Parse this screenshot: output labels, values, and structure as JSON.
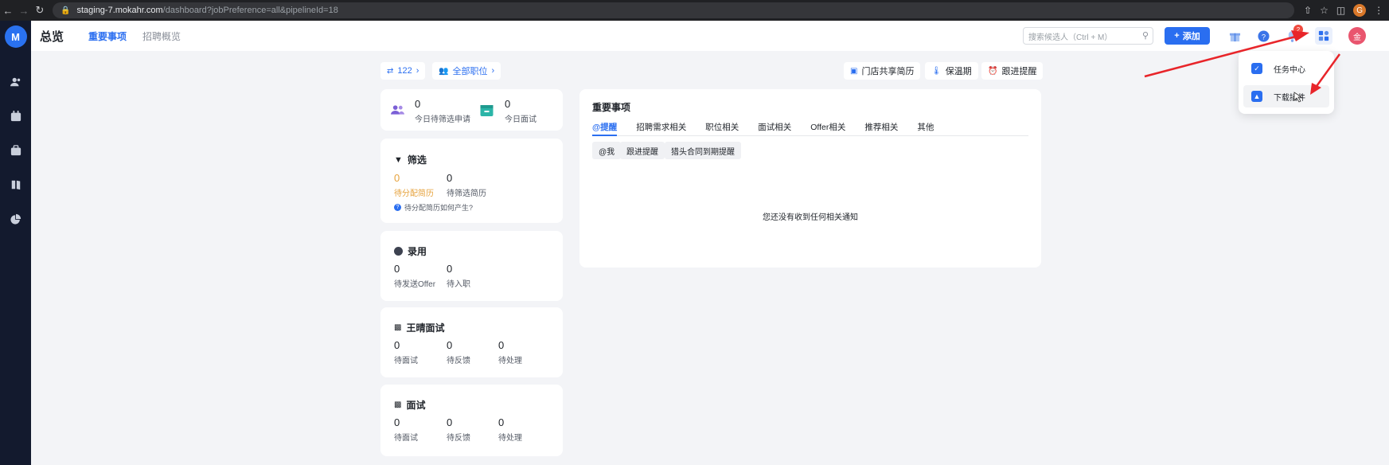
{
  "browser": {
    "url_host": "staging-7.mokahr.com",
    "url_path": "/dashboard?jobPreference=all&pipelineId=18",
    "profile_initial": "G"
  },
  "sidebar": {
    "logo_text": "M"
  },
  "header": {
    "title": "总览",
    "tabs": [
      {
        "label": "重要事项"
      },
      {
        "label": "招聘概览"
      }
    ],
    "search_placeholder": "搜索候选人（Ctrl + M）",
    "add_label": "添加",
    "notification_count": "2",
    "avatar_text": "金"
  },
  "filters": {
    "pipeline": "122",
    "jobs": "全部职位",
    "store_resume": "门店共享简历",
    "warranty": "保温期",
    "followup": "跟进提醒"
  },
  "today": {
    "screen_count": "0",
    "screen_label": "今日待筛选申请",
    "interview_count": "0",
    "interview_label": "今日面试"
  },
  "screening": {
    "title": "筛选",
    "to_assign_count": "0",
    "to_assign_label": "待分配简历",
    "to_screen_count": "0",
    "to_screen_label": "待筛选简历",
    "hint": "待分配简历如何产生?"
  },
  "hiring": {
    "title": "录用",
    "to_send_count": "0",
    "to_send_label": "待发送Offer",
    "to_onboard_count": "0",
    "to_onboard_label": "待入职"
  },
  "interview_a": {
    "title": "王晴面试",
    "pending_count": "0",
    "pending_label": "待面试",
    "feedback_count": "0",
    "feedback_label": "待反馈",
    "process_count": "0",
    "process_label": "待处理"
  },
  "interview_b": {
    "title": "面试",
    "pending_count": "0",
    "pending_label": "待面试",
    "feedback_count": "0",
    "feedback_label": "待反馈",
    "process_count": "0",
    "process_label": "待处理"
  },
  "main": {
    "title": "重要事项",
    "tabs": [
      {
        "label": "@提醒"
      },
      {
        "label": "招聘需求相关"
      },
      {
        "label": "职位相关"
      },
      {
        "label": "面试相关"
      },
      {
        "label": "Offer相关"
      },
      {
        "label": "推荐相关"
      },
      {
        "label": "其他"
      }
    ],
    "subfilters": [
      {
        "label": "@我"
      },
      {
        "label": "跟进提醒"
      },
      {
        "label": "猎头合同到期提醒"
      }
    ],
    "empty_text": "您还没有收到任何相关通知"
  },
  "dropdown": {
    "items": [
      {
        "label": "任务中心"
      },
      {
        "label": "下载插件"
      }
    ]
  },
  "colors": {
    "accent": "#2a6ef0",
    "sidebar": "#131a2e",
    "annotation": "#e8252a",
    "warning": "#e6a23c"
  }
}
